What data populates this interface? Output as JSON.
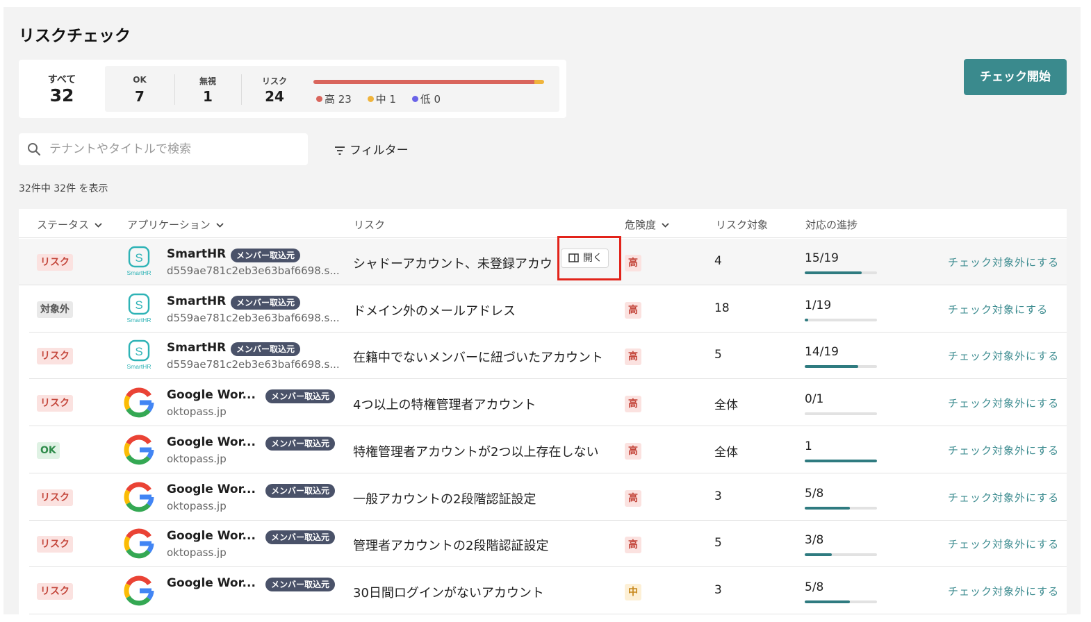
{
  "page": {
    "title": "リスクチェック"
  },
  "summary": {
    "total_label": "すべて",
    "total_value": "32",
    "ok_label": "OK",
    "ok_value": "7",
    "ignore_label": "無視",
    "ignore_value": "1",
    "risk_label": "リスク",
    "risk_value": "24",
    "legend": {
      "high": "高 23",
      "mid": "中 1",
      "low": "低 0"
    },
    "bar": {
      "high": 23,
      "mid": 1,
      "low": 0,
      "high_color": "#d9655c",
      "mid_color": "#f0b43c",
      "low_color": "#6a63e8"
    }
  },
  "start_button": {
    "label": "チェック開始",
    "color": "#3a8a8d"
  },
  "search": {
    "placeholder": "テナントやタイトルで検索",
    "value": ""
  },
  "filter": {
    "label": "フィルター"
  },
  "result_count": "32件中 32件 を表示",
  "table": {
    "headers": {
      "status": "ステータス",
      "app": "アプリケーション",
      "risk": "リスク",
      "danger": "危険度",
      "target": "リスク対象",
      "progress": "対応の進捗"
    },
    "open_button": "開く",
    "rows": [
      {
        "status": "リスク",
        "status_type": "risk",
        "icon": "smarthr-icon",
        "app": "SmartHR",
        "tag": "メンバー取込元",
        "sub": "d559ae781c2eb3e63baf6698.s...",
        "risk": "シャドーアカウント、未登録アカウ",
        "danger": "高",
        "danger_type": "high",
        "target": "4",
        "progress": "15/19",
        "progress_ratio": 0.79,
        "action": "チェック対象外にする"
      },
      {
        "status": "対象外",
        "status_type": "out",
        "icon": "smarthr-icon",
        "app": "SmartHR",
        "tag": "メンバー取込元",
        "sub": "d559ae781c2eb3e63baf6698.s...",
        "risk": "ドメイン外のメールアドレス",
        "danger": "高",
        "danger_type": "high",
        "target": "18",
        "progress": "1/19",
        "progress_ratio": 0.05,
        "action": "チェック対象にする"
      },
      {
        "status": "リスク",
        "status_type": "risk",
        "icon": "smarthr-icon",
        "app": "SmartHR",
        "tag": "メンバー取込元",
        "sub": "d559ae781c2eb3e63baf6698.s...",
        "risk": "在籍中でないメンバーに紐づいたアカウント",
        "danger": "高",
        "danger_type": "high",
        "target": "5",
        "progress": "14/19",
        "progress_ratio": 0.74,
        "action": "チェック対象外にする"
      },
      {
        "status": "リスク",
        "status_type": "risk",
        "icon": "google-icon",
        "app": "Google Wor...",
        "tag": "メンバー取込元",
        "sub": "oktopass.jp",
        "risk": "4つ以上の特権管理者アカウント",
        "danger": "高",
        "danger_type": "high",
        "target": "全体",
        "progress": "0/1",
        "progress_ratio": 0,
        "action": "チェック対象外にする"
      },
      {
        "status": "OK",
        "status_type": "ok",
        "icon": "google-icon",
        "app": "Google Wor...",
        "tag": "メンバー取込元",
        "sub": "oktopass.jp",
        "risk": "特権管理者アカウントが2つ以上存在しない",
        "danger": "高",
        "danger_type": "high",
        "target": "全体",
        "progress": "1",
        "progress_ratio": 1,
        "action": "チェック対象外にする"
      },
      {
        "status": "リスク",
        "status_type": "risk",
        "icon": "google-icon",
        "app": "Google Wor...",
        "tag": "メンバー取込元",
        "sub": "oktopass.jp",
        "risk": "一般アカウントの2段階認証設定",
        "danger": "高",
        "danger_type": "high",
        "target": "3",
        "progress": "5/8",
        "progress_ratio": 0.625,
        "action": "チェック対象外にする"
      },
      {
        "status": "リスク",
        "status_type": "risk",
        "icon": "google-icon",
        "app": "Google Wor...",
        "tag": "メンバー取込元",
        "sub": "oktopass.jp",
        "risk": "管理者アカウントの2段階認証設定",
        "danger": "高",
        "danger_type": "high",
        "target": "5",
        "progress": "3/8",
        "progress_ratio": 0.375,
        "action": "チェック対象外にする"
      },
      {
        "status": "リスク",
        "status_type": "risk",
        "icon": "google-icon",
        "app": "Google Wor...",
        "tag": "メンバー取込元",
        "sub": "",
        "risk": "30日間ログインがないアカウント",
        "danger": "中",
        "danger_type": "mid",
        "target": "3",
        "progress": "5/8",
        "progress_ratio": 0.625,
        "action": "チェック対象外にする"
      }
    ]
  }
}
